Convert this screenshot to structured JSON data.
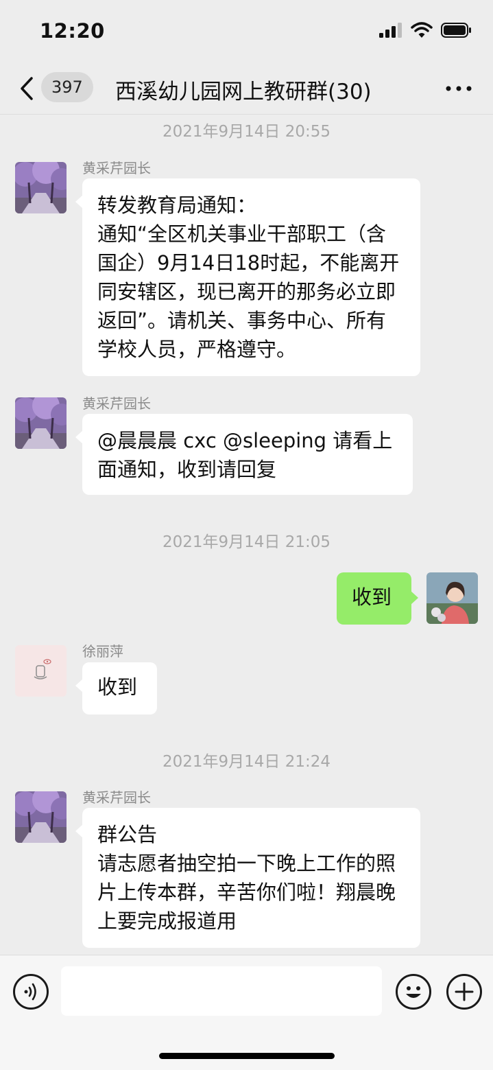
{
  "status": {
    "time": "12:20"
  },
  "nav": {
    "badge": "397",
    "title": "西溪幼儿园网上教研群(30)"
  },
  "timestamps": [
    "2021年9月14日 20:55",
    "2021年9月14日 21:05",
    "2021年9月14日 21:24"
  ],
  "messages": [
    {
      "sender": "黄采芹园长",
      "text": "转发教育局通知：\n通知“全区机关事业干部职工（含国企）9月14日18时起，不能离开同安辖区，现已离开的那务必立即返回”。请机关、事务中心、所有学校人员，严格遵守。"
    },
    {
      "sender": "黄采芹园长",
      "text": "@晨晨晨 cxc @sleeping 请看上面通知，收到请回复"
    },
    {
      "sender": "",
      "text": "收到"
    },
    {
      "sender": "徐丽萍",
      "text": "收到"
    },
    {
      "sender": "黄采芹园长",
      "text": "群公告\n请志愿者抽空拍一下晚上工作的照片上传本群，辛苦你们啦！翔晨晚上要完成报道用"
    }
  ],
  "input": {
    "placeholder": ""
  },
  "icons": {
    "back": "chevron-left-icon",
    "more": "more-dots-icon",
    "voice": "voice-icon",
    "emoji": "emoji-icon",
    "add": "plus-icon"
  },
  "colors": {
    "background": "#ededed",
    "bubble_self": "#95ec69",
    "bubble_other": "#ffffff"
  }
}
